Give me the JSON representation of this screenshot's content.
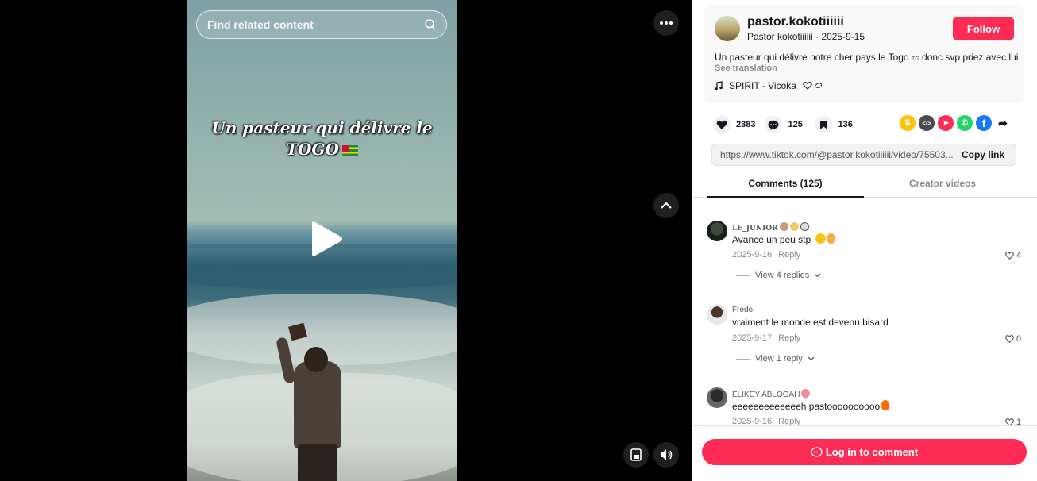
{
  "search": {
    "placeholder": "Find related content"
  },
  "video": {
    "overlay_line1": "Un pasteur qui délivre le",
    "overlay_line2": "TOGO"
  },
  "author": {
    "username": "pastor.kokotiiiiii",
    "display_name": "Pastor kokotiiiiii",
    "date": "2025-9-15",
    "follow_label": "Follow"
  },
  "post": {
    "description_main": "Un pasteur qui délivre notre cher pays le Togo",
    "description_tg": "TG",
    "description_end": "donc svp priez avec lui",
    "see_translation": "See translation",
    "music": "SPIRIT - Vicoka"
  },
  "stats": {
    "likes": "2383",
    "comments": "125",
    "saves": "136"
  },
  "link": {
    "url": "https://www.tiktok.com/@pastor.kokotiiiiii/video/75503...",
    "copy_label": "Copy link"
  },
  "tabs": {
    "comments": "Comments (125)",
    "creator_videos": "Creator videos"
  },
  "comments": [
    {
      "name": "LE_JUNIOR",
      "text": "Avance un peu stp",
      "date": "2025-9-16",
      "reply": "Reply",
      "likes": "4",
      "view_replies": "View 4 replies"
    },
    {
      "name": "Fredo",
      "text": "vraiment le monde est devenu bisard",
      "date": "2025-9-17",
      "reply": "Reply",
      "likes": "0",
      "view_replies": "View 1 reply"
    },
    {
      "name": "ELIKEY ABLOGAH",
      "text": "eeeeeeeeeeeeeh pastoooooooooo",
      "date": "2025-9-16",
      "reply": "Reply",
      "likes": "1"
    }
  ],
  "login": {
    "label": "Log in to comment"
  },
  "colors": {
    "accent": "#fe2c55",
    "text": "#161823",
    "muted": "#8a8b91"
  }
}
